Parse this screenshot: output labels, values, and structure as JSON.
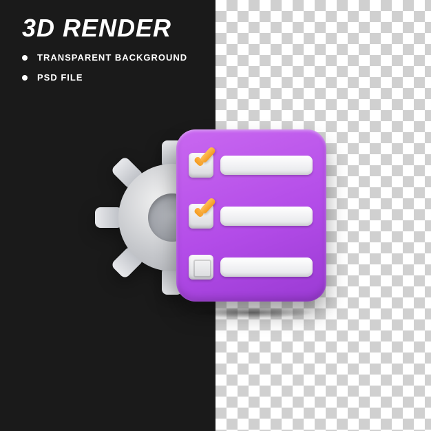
{
  "header": {
    "title": "3D RENDER",
    "bullets": [
      "TRANSPARENT BACKGROUND",
      "PSD FILE"
    ]
  },
  "illustration": {
    "gear_icon": "gear-icon",
    "card_color": "#b34ce8",
    "checklist": [
      {
        "checked": true
      },
      {
        "checked": true
      },
      {
        "checked": false
      }
    ]
  }
}
